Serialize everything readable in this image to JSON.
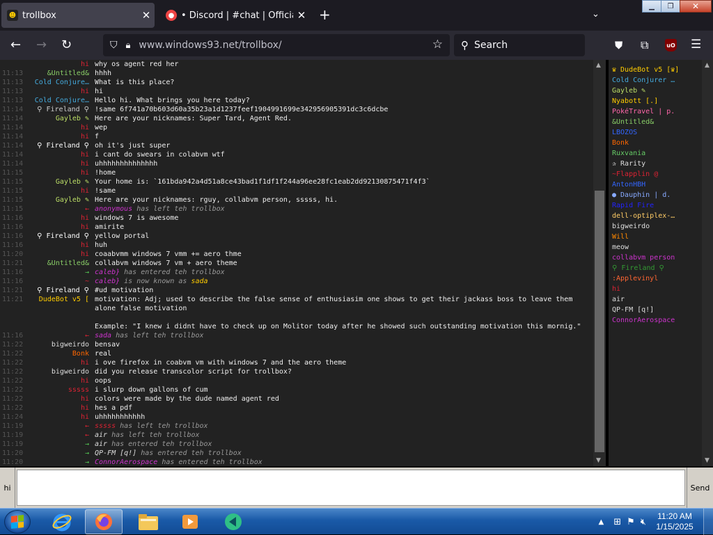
{
  "browser": {
    "tabs": [
      {
        "title": "trollbox",
        "active": true
      },
      {
        "title": "• Discord | #chat | Official THX",
        "active": false
      }
    ],
    "url_host": "www.windows93.net",
    "url_path": "/trollbox/",
    "search_placeholder": "Search"
  },
  "chat": {
    "messages": [
      {
        "time": "",
        "nick": "hi",
        "nick_color": "#d23",
        "text": "why os agent red her",
        "system": false
      },
      {
        "time": "11:13",
        "nick": "&Untitled&",
        "nick_color": "#8c6",
        "text": "hhhh",
        "system": false
      },
      {
        "time": "11:13",
        "nick": "Cold Conjure…",
        "nick_color": "#4ad",
        "text": "What is this place?",
        "system": false
      },
      {
        "time": "11:13",
        "nick": "hi",
        "nick_color": "#d23",
        "text": "hi",
        "system": false
      },
      {
        "time": "11:13",
        "nick": "Cold Conjure…",
        "nick_color": "#4ad",
        "text": "Hello hi. What brings you here today?",
        "system": false
      },
      {
        "time": "11:14",
        "nick": "⚲ Fireland ⚲",
        "nick_color": "#ccc",
        "text": "!same 6f741a70b603d60a35b23a1d1237feef1904991699e342956905391dc3c6dcbe",
        "system": false
      },
      {
        "time": "11:14",
        "nick": "Gayleb ✎",
        "nick_color": "#bd6",
        "text": "Here are your nicknames: Super Tard, Agent Red.",
        "system": false
      },
      {
        "time": "11:14",
        "nick": "hi",
        "nick_color": "#d23",
        "text": "wep",
        "system": false
      },
      {
        "time": "11:14",
        "nick": "hi",
        "nick_color": "#d23",
        "text": "f",
        "system": false
      },
      {
        "time": "11:14",
        "nick": "⚲ Fireland ⚲",
        "nick_color": "#fff",
        "text": "oh it's just super",
        "system": false
      },
      {
        "time": "11:14",
        "nick": "hi",
        "nick_color": "#d23",
        "text": "i cant do swears in colabvm wtf",
        "system": false
      },
      {
        "time": "11:14",
        "nick": "hi",
        "nick_color": "#d23",
        "text": "uhhhhhhhhhhhhhh",
        "system": false
      },
      {
        "time": "11:15",
        "nick": "hi",
        "nick_color": "#d23",
        "text": "!home",
        "system": false
      },
      {
        "time": "11:15",
        "nick": "Gayleb ✎",
        "nick_color": "#bd6",
        "text": "Your home is: `161bda942a4d51a8ce43bad1f1df1f244a96ee28fc1eab2dd92130875471f4f3`",
        "system": false
      },
      {
        "time": "11:15",
        "nick": "hi",
        "nick_color": "#d23",
        "text": "!same",
        "system": false
      },
      {
        "time": "11:15",
        "nick": "Gayleb ✎",
        "nick_color": "#bd6",
        "text": "Here are your nicknames: rguy, collabvm person, sssss, hi.",
        "system": false
      },
      {
        "time": "11:15",
        "nick": "←",
        "nick_color": "#d23",
        "text": "anonymous has left teh trollbox",
        "system": true,
        "actor": "anonymous",
        "actor_color": "#c3c"
      },
      {
        "time": "11:16",
        "nick": "hi",
        "nick_color": "#d23",
        "text": "windows 7 is awesome",
        "system": false
      },
      {
        "time": "11:16",
        "nick": "hi",
        "nick_color": "#d23",
        "text": "amirite",
        "system": false
      },
      {
        "time": "11:16",
        "nick": "⚲ Fireland ⚲",
        "nick_color": "#fff",
        "text": "yellow portal",
        "system": false
      },
      {
        "time": "11:16",
        "nick": "hi",
        "nick_color": "#d23",
        "text": "huh",
        "system": false
      },
      {
        "time": "11:20",
        "nick": "hi",
        "nick_color": "#d23",
        "text": "coaabvmm windows 7 vmm += aero thme",
        "system": false
      },
      {
        "time": "11:21",
        "nick": "&Untitled&",
        "nick_color": "#8c6",
        "text": "collabvm windows 7 vm + aero theme",
        "system": false
      },
      {
        "time": "11:16",
        "nick": "→",
        "nick_color": "#5c5",
        "text": "caleb} has entered teh trollbox",
        "system": true,
        "actor": "caleb}",
        "actor_color": "#c3c"
      },
      {
        "time": "11:16",
        "nick": "~",
        "nick_color": "#d23",
        "text": "caleb} is now known as sada",
        "system": true,
        "actor": "caleb}",
        "actor_color": "#c3c"
      },
      {
        "time": "11:21",
        "nick": "⚲ Fireland ⚲",
        "nick_color": "#fff",
        "text": "#ud motivation",
        "system": false
      },
      {
        "time": "11:21",
        "nick": "DudeBot v5 [",
        "nick_color": "#fc0",
        "text": "motivation: Adj; used to describe the false sense of enthusiasim one shows to get their jackass boss to leave them alone false motivation\n\nExample: \"I knew i didnt have to check up on Molitor today after he showed such outstanding motivation this mornig.\"",
        "system": false
      },
      {
        "time": "11:16",
        "nick": "←",
        "nick_color": "#d23",
        "text": "sada has left teh trollbox",
        "system": true,
        "actor": "sada",
        "actor_color": "#c3c"
      },
      {
        "time": "11:22",
        "nick": "bigweirdo",
        "nick_color": "#ddd",
        "text": "bensav",
        "system": false
      },
      {
        "time": "11:22",
        "nick": "Bonk",
        "nick_color": "#f60",
        "text": "real",
        "system": false
      },
      {
        "time": "11:22",
        "nick": "hi",
        "nick_color": "#d23",
        "text": "i ove firefox in coabvm vm with windows 7 and the aero theme",
        "system": false
      },
      {
        "time": "11:22",
        "nick": "bigweirdo",
        "nick_color": "#ddd",
        "text": "did you release transcolor script for trollbox?",
        "system": false
      },
      {
        "time": "11:22",
        "nick": "hi",
        "nick_color": "#d23",
        "text": "oops",
        "system": false
      },
      {
        "time": "11:22",
        "nick": "sssss",
        "nick_color": "#d23",
        "text": "i slurp down gallons of cum",
        "system": false
      },
      {
        "time": "11:22",
        "nick": "hi",
        "nick_color": "#d23",
        "text": "colors were made by the dude named agent red",
        "system": false
      },
      {
        "time": "11:22",
        "nick": "hi",
        "nick_color": "#d23",
        "text": "hes a pdf",
        "system": false
      },
      {
        "time": "11:24",
        "nick": "hi",
        "nick_color": "#d23",
        "text": "uhhhhhhhhhhh",
        "system": false
      },
      {
        "time": "11:19",
        "nick": "←",
        "nick_color": "#d23",
        "text": "sssss has left teh trollbox",
        "system": true,
        "actor": "sssss",
        "actor_color": "#d23"
      },
      {
        "time": "11:19",
        "nick": "←",
        "nick_color": "#d23",
        "text": "air has left teh trollbox",
        "system": true,
        "actor": "air",
        "actor_color": "#ddd"
      },
      {
        "time": "11:19",
        "nick": "→",
        "nick_color": "#5c5",
        "text": "air has entered teh trollbox",
        "system": true,
        "actor": "air",
        "actor_color": "#ddd"
      },
      {
        "time": "11:20",
        "nick": "→",
        "nick_color": "#5c5",
        "text": "QP-FM [q!] has entered teh trollbox",
        "system": true,
        "actor": "QP-FM [q!]",
        "actor_color": "#ddd"
      },
      {
        "time": "11:20",
        "nick": "→",
        "nick_color": "#5c5",
        "text": "ConnorAerospace has entered teh trollbox",
        "system": true,
        "actor": "ConnorAerospace",
        "actor_color": "#c3c"
      }
    ]
  },
  "users": [
    {
      "name": "♛ DudeBot v5 [♛]",
      "color": "#fc0"
    },
    {
      "name": "Cold Conjurer …",
      "color": "#4ad"
    },
    {
      "name": "Gayleb ✎",
      "color": "#bd6"
    },
    {
      "name": "Nyabott [.]",
      "color": "#fc0"
    },
    {
      "name": "PokéTravel | p.",
      "color": "#f6a"
    },
    {
      "name": "&Untitled&",
      "color": "#8c6"
    },
    {
      "name": "LBOZOS",
      "color": "#36f"
    },
    {
      "name": "Bonk",
      "color": "#f60"
    },
    {
      "name": "Ruxvania",
      "color": "#6c6"
    },
    {
      "name": "✰ Rarity",
      "color": "#ddd"
    },
    {
      "name": "~Flapplin @",
      "color": "#d23"
    },
    {
      "name": "AntonHBH",
      "color": "#36f"
    },
    {
      "name": "● Dauphin | d.",
      "color": "#8af"
    },
    {
      "name": "Rapid Fire",
      "color": "#22f"
    },
    {
      "name": "dell-optiplex-…",
      "color": "#fc6"
    },
    {
      "name": "bigweirdo",
      "color": "#ddd"
    },
    {
      "name": "Will",
      "color": "#f80"
    },
    {
      "name": "meow",
      "color": "#ddd"
    },
    {
      "name": "collabvm person",
      "color": "#c3c"
    },
    {
      "name": "⚲ Fireland ⚲",
      "color": "#393"
    },
    {
      "name": ":Applevinyl",
      "color": "#f63"
    },
    {
      "name": "hi",
      "color": "#d23"
    },
    {
      "name": "air",
      "color": "#ddd"
    },
    {
      "name": "QP-FM [q!]",
      "color": "#ddd"
    },
    {
      "name": "ConnorAerospace",
      "color": "#c3c"
    }
  ],
  "input": {
    "nick_button": "hi",
    "value": "",
    "send_label": "Send"
  },
  "taskbar": {
    "time": "11:20 AM",
    "date": "1/15/2025"
  }
}
